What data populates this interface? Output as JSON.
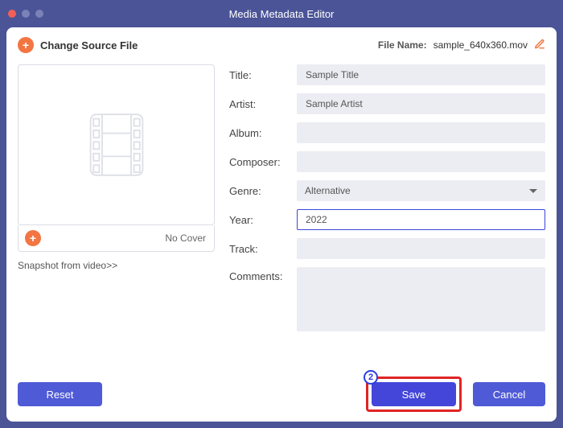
{
  "window": {
    "title": "Media Metadata Editor"
  },
  "topbar": {
    "change_source_label": "Change Source File",
    "filename_label": "File Name:",
    "filename_value": "sample_640x360.mov"
  },
  "cover": {
    "no_cover_label": "No Cover",
    "snapshot_link": "Snapshot from video>>"
  },
  "form": {
    "title": {
      "label": "Title:",
      "value": "Sample Title"
    },
    "artist": {
      "label": "Artist:",
      "value": "Sample Artist"
    },
    "album": {
      "label": "Album:",
      "value": ""
    },
    "composer": {
      "label": "Composer:",
      "value": ""
    },
    "genre": {
      "label": "Genre:",
      "value": "Alternative"
    },
    "year": {
      "label": "Year:",
      "value": "2022"
    },
    "track": {
      "label": "Track:",
      "value": ""
    },
    "comments": {
      "label": "Comments:",
      "value": ""
    }
  },
  "buttons": {
    "reset": "Reset",
    "save": "Save",
    "cancel": "Cancel"
  },
  "callout": {
    "save_badge": "2"
  }
}
